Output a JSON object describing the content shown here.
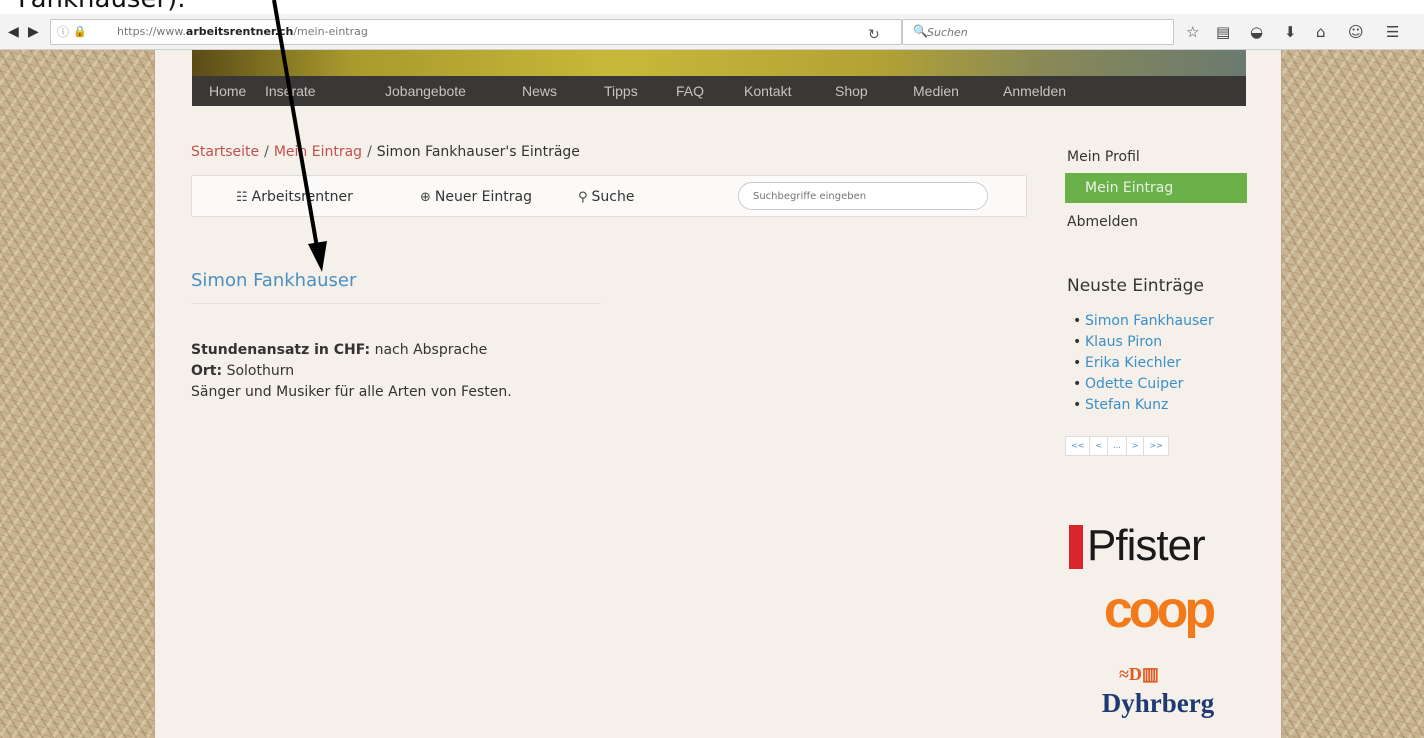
{
  "caption": {
    "text": "Fankhauser)."
  },
  "browser": {
    "url_prefix": "https://www.",
    "url_domain": "arbeitsrentner.ch",
    "url_path": "/mein-eintrag",
    "search_placeholder": "Suchen"
  },
  "nav": {
    "items": [
      "Home",
      "Inserate",
      "Jobangebote",
      "News",
      "Tipps",
      "FAQ",
      "Kontakt",
      "Shop",
      "Medien",
      "Anmelden"
    ]
  },
  "breadcrumb": {
    "home": "Startseite",
    "sep": "/",
    "section": "Mein Eintrag",
    "current": "Simon Fankhauser's Einträge"
  },
  "subbar": {
    "list_label": "Arbeitsrentner",
    "new_label": "Neuer Eintrag",
    "search_label": "Suche",
    "search_placeholder": "Suchbegriffe eingeben"
  },
  "entry": {
    "title": "Simon Fankhauser",
    "rate_label": "Stundenansatz in CHF:",
    "rate_value": "nach Absprache",
    "place_label": "Ort:",
    "place_value": "Solothurn",
    "description": "Sänger und Musiker für alle Arten von Festen."
  },
  "sidebar": {
    "profile": "Mein Profil",
    "my_entry": "Mein Eintrag",
    "logout": "Abmelden",
    "recent_heading": "Neuste Einträge",
    "recent": [
      "Simon Fankhauser",
      "Klaus Piron",
      "Erika Kiechler",
      "Odette Cuiper",
      "Stefan Kunz"
    ],
    "pager": [
      "<<",
      "<",
      "...",
      ">",
      ">>"
    ]
  },
  "sponsors": {
    "pfister": "Pfister",
    "coop": "coop",
    "dyhrberg": "Dyhrberg"
  },
  "colors": {
    "accent_green": "#6ab14a",
    "link_blue": "#3b8fc9",
    "breadcrumb_red": "#c0504d",
    "nav_bg": "#3a3836"
  }
}
